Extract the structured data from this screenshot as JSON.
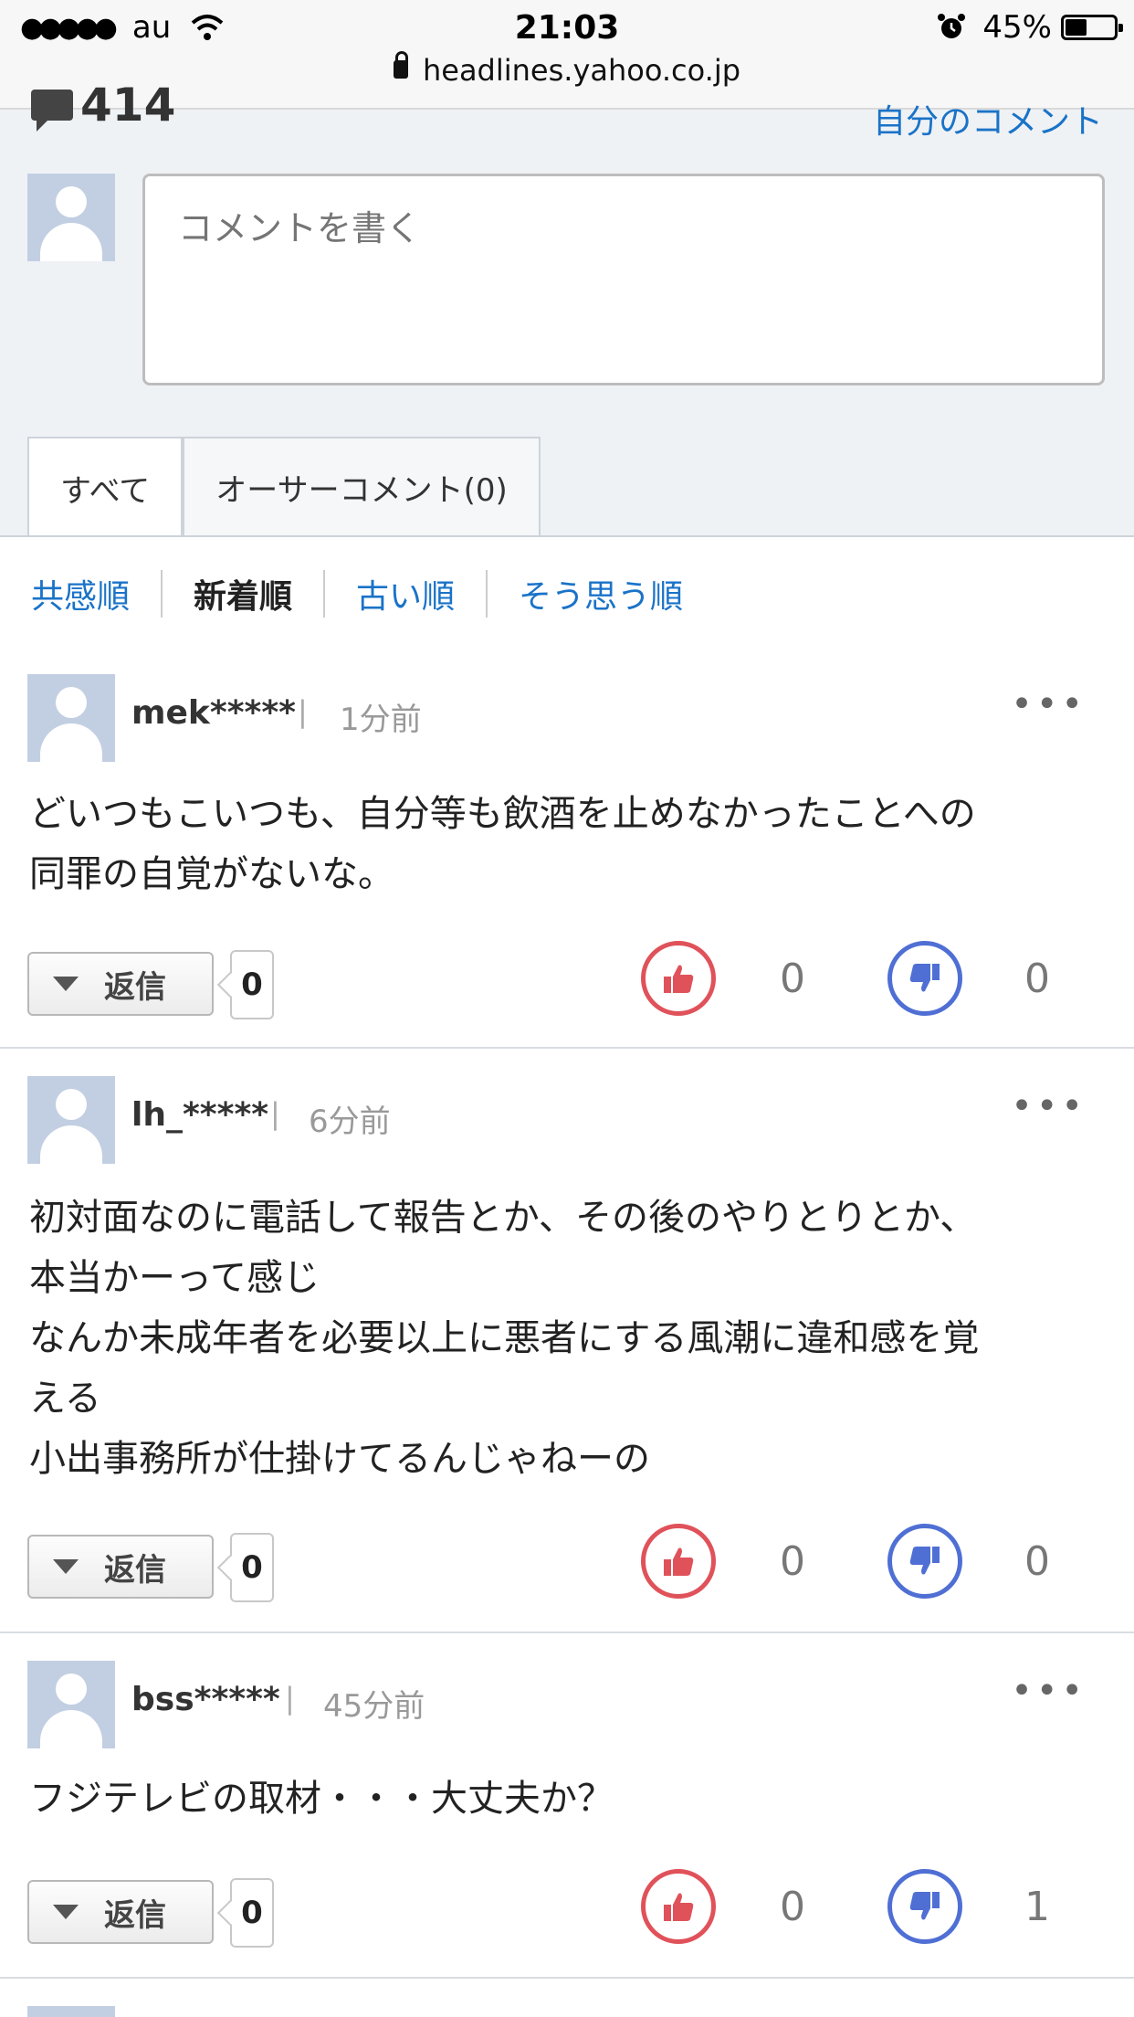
{
  "status_bar": {
    "signal_dots": "●●●●●",
    "carrier": "au",
    "time": "21:03",
    "battery_pct": "45%",
    "battery_level": 0.45
  },
  "browser": {
    "url": "headlines.yahoo.co.jp"
  },
  "header": {
    "comment_count": "414",
    "my_comments_link": "自分のコメント",
    "comment_placeholder": "コメントを書く"
  },
  "tabs": [
    {
      "label": "すべて",
      "active": true
    },
    {
      "label": "オーサーコメント(0)",
      "active": false
    }
  ],
  "sort_options": [
    {
      "label": "共感順",
      "current": false
    },
    {
      "label": "新着順",
      "current": true
    },
    {
      "label": "古い順",
      "current": false
    },
    {
      "label": "そう思う順",
      "current": false
    }
  ],
  "comments": [
    {
      "user": "mek*****",
      "time": "1分前",
      "text": "どいつもこいつも、自分等も飲酒を止めなかったことへの\n同罪の自覚がないな。",
      "reply_label": "返信",
      "reply_count": "0",
      "agree": "0",
      "disagree": "0"
    },
    {
      "user": "lh_*****",
      "time": "6分前",
      "text": "初対面なのに電話して報告とか、その後のやりとりとか、\n本当かーって感じ\nなんか未成年者を必要以上に悪者にする風潮に違和感を覚\nえる\n小出事務所が仕掛けてるんじゃねーの",
      "reply_label": "返信",
      "reply_count": "0",
      "agree": "0",
      "disagree": "0"
    },
    {
      "user": "bss*****",
      "time": "45分前",
      "text": "フジテレビの取材・・・大丈夫か？",
      "reply_label": "返信",
      "reply_count": "0",
      "agree": "0",
      "disagree": "1"
    }
  ],
  "more_menu_glyph": "•••",
  "colors": {
    "link": "#1a73c8",
    "agree": "#e0525a",
    "disagree": "#4f6fd4"
  }
}
